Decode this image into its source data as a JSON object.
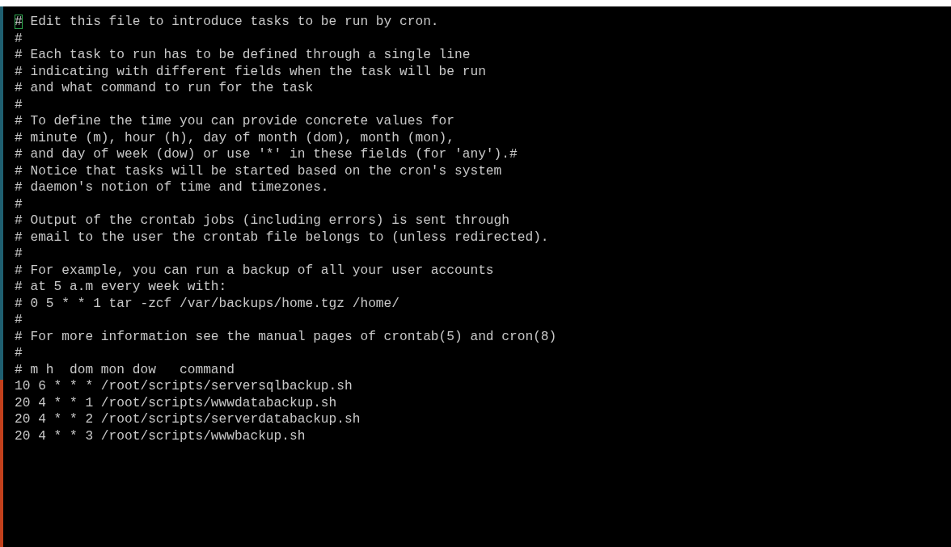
{
  "terminal": {
    "lines": [
      {
        "text": "# Edit this file to introduce tasks to be run by cron.",
        "cursor": true
      },
      {
        "text": "#",
        "cursor": false
      },
      {
        "text": "# Each task to run has to be defined through a single line",
        "cursor": false
      },
      {
        "text": "# indicating with different fields when the task will be run",
        "cursor": false
      },
      {
        "text": "# and what command to run for the task",
        "cursor": false
      },
      {
        "text": "#",
        "cursor": false
      },
      {
        "text": "# To define the time you can provide concrete values for",
        "cursor": false
      },
      {
        "text": "# minute (m), hour (h), day of month (dom), month (mon),",
        "cursor": false
      },
      {
        "text": "# and day of week (dow) or use '*' in these fields (for 'any').#",
        "cursor": false
      },
      {
        "text": "# Notice that tasks will be started based on the cron's system",
        "cursor": false
      },
      {
        "text": "# daemon's notion of time and timezones.",
        "cursor": false
      },
      {
        "text": "#",
        "cursor": false
      },
      {
        "text": "# Output of the crontab jobs (including errors) is sent through",
        "cursor": false
      },
      {
        "text": "# email to the user the crontab file belongs to (unless redirected).",
        "cursor": false
      },
      {
        "text": "#",
        "cursor": false
      },
      {
        "text": "# For example, you can run a backup of all your user accounts",
        "cursor": false
      },
      {
        "text": "# at 5 a.m every week with:",
        "cursor": false
      },
      {
        "text": "# 0 5 * * 1 tar -zcf /var/backups/home.tgz /home/",
        "cursor": false
      },
      {
        "text": "#",
        "cursor": false
      },
      {
        "text": "# For more information see the manual pages of crontab(5) and cron(8)",
        "cursor": false
      },
      {
        "text": "#",
        "cursor": false
      },
      {
        "text": "# m h  dom mon dow   command",
        "cursor": false
      },
      {
        "text": "10 6 * * * /root/scripts/serversqlbackup.sh",
        "cursor": false
      },
      {
        "text": "20 4 * * 1 /root/scripts/wwwdatabackup.sh",
        "cursor": false
      },
      {
        "text": "20 4 * * 2 /root/scripts/serverdatabackup.sh",
        "cursor": false
      },
      {
        "text": "20 4 * * 3 /root/scripts/wwwbackup.sh",
        "cursor": false
      }
    ]
  }
}
